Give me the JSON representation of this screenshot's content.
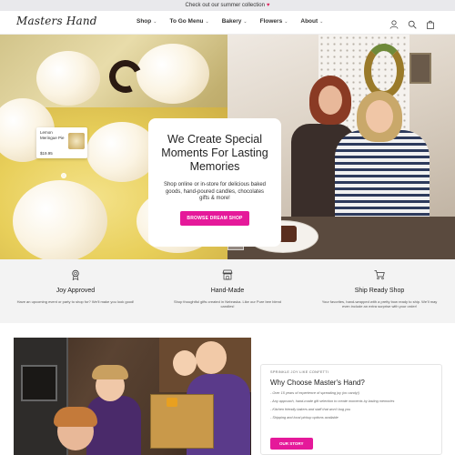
{
  "announcement": {
    "text": "Check out our summer collection",
    "icon": "heart"
  },
  "header": {
    "logo": "Masters Hand",
    "nav": [
      {
        "label": "Shop"
      },
      {
        "label": "To Go Menu"
      },
      {
        "label": "Bakery"
      },
      {
        "label": "Flowers"
      },
      {
        "label": "About"
      }
    ],
    "icons": [
      "account-icon",
      "search-icon",
      "cart-icon"
    ]
  },
  "hero": {
    "title": "We Create Special Moments For Lasting Memories",
    "subtitle": "Shop online or in-store for delicious baked goods, hand-poured candles, chocolates gifts & more!",
    "cta": "BROWSE DREAM SHOP",
    "product_tag": {
      "name": "Lemon Meringue Pie",
      "price": "$19.95"
    }
  },
  "features": [
    {
      "icon": "award-icon",
      "title": "Joy Approved",
      "desc": "Have an upcoming event or party to shop for? We'll make you look good!"
    },
    {
      "icon": "shop-icon",
      "title": "Hand-Made",
      "desc": "Shop thoughtful gifts created in Nebraska. Like our Pure bee blend candles!"
    },
    {
      "icon": "cart-icon",
      "title": "Ship Ready Shop",
      "desc": "Your favorites, hand-wrapped with a pretty bow ready to ship. We'll may even include an extra surprise with your order!"
    }
  ],
  "story": {
    "eyebrow": "SPRINKLE JOY LIKE CONFETTI",
    "title": "Why Choose Master's Hand?",
    "bullets": [
      "- Over 15 years of experience of spreading joy (no candy!)",
      "- Any approach, hand-made gift selection to create moments by lasting memories",
      "- Kitchen friendly bakers and staff that won't bug you",
      "- Shipping and local pickup options available"
    ],
    "button": "OUR STORY"
  },
  "colors": {
    "accent": "#e5199a",
    "announcement_bg": "#e9e9ec",
    "feature_bg": "#f3f3f3"
  }
}
